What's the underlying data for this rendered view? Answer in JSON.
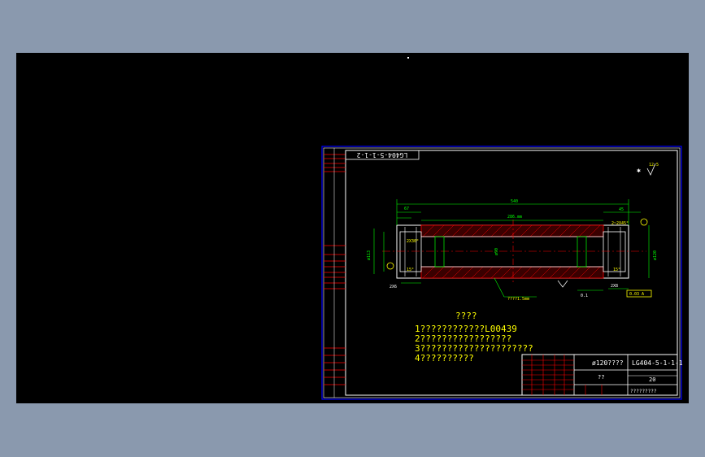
{
  "app": {
    "background_color": "#8a99ae",
    "viewport_color": "#000000"
  },
  "sheet": {
    "rotated_code": "LG404-5-1-1-2",
    "tech_title": "????",
    "notes": [
      "1????????????L00439",
      "2?????????????????",
      "3?????????????????????",
      "4??????????"
    ],
    "material_label": "ø120????",
    "drawing_number": "LG404-5-1-1-1",
    "part_name": "??",
    "qty": "20",
    "company": "?????????",
    "roughness_main": "12.5",
    "roughness_other": "✱",
    "datum_box": "0.03 A",
    "dims": {
      "total_length": "540",
      "right_end": "45",
      "left_end": "67",
      "inner_span": "286.mm",
      "chamfer_right": "2~2X45°",
      "chamfer_left": "2X30°",
      "left_bore": "ø113",
      "right_bore": "ø120",
      "center": "ø90",
      "bottom_label": "????1.5mm",
      "angle_left": "15°",
      "angle_right": "15°",
      "bottom_left": "2X6",
      "bottom_right1": "0.1",
      "bottom_right2": "2X8"
    },
    "colors": {
      "frame": "#0000ff",
      "line_white": "#ffffff",
      "dimension": "#00ff00",
      "hatch": "#ff0000",
      "text": "#ffff00",
      "centerline": "#ff0000"
    }
  }
}
